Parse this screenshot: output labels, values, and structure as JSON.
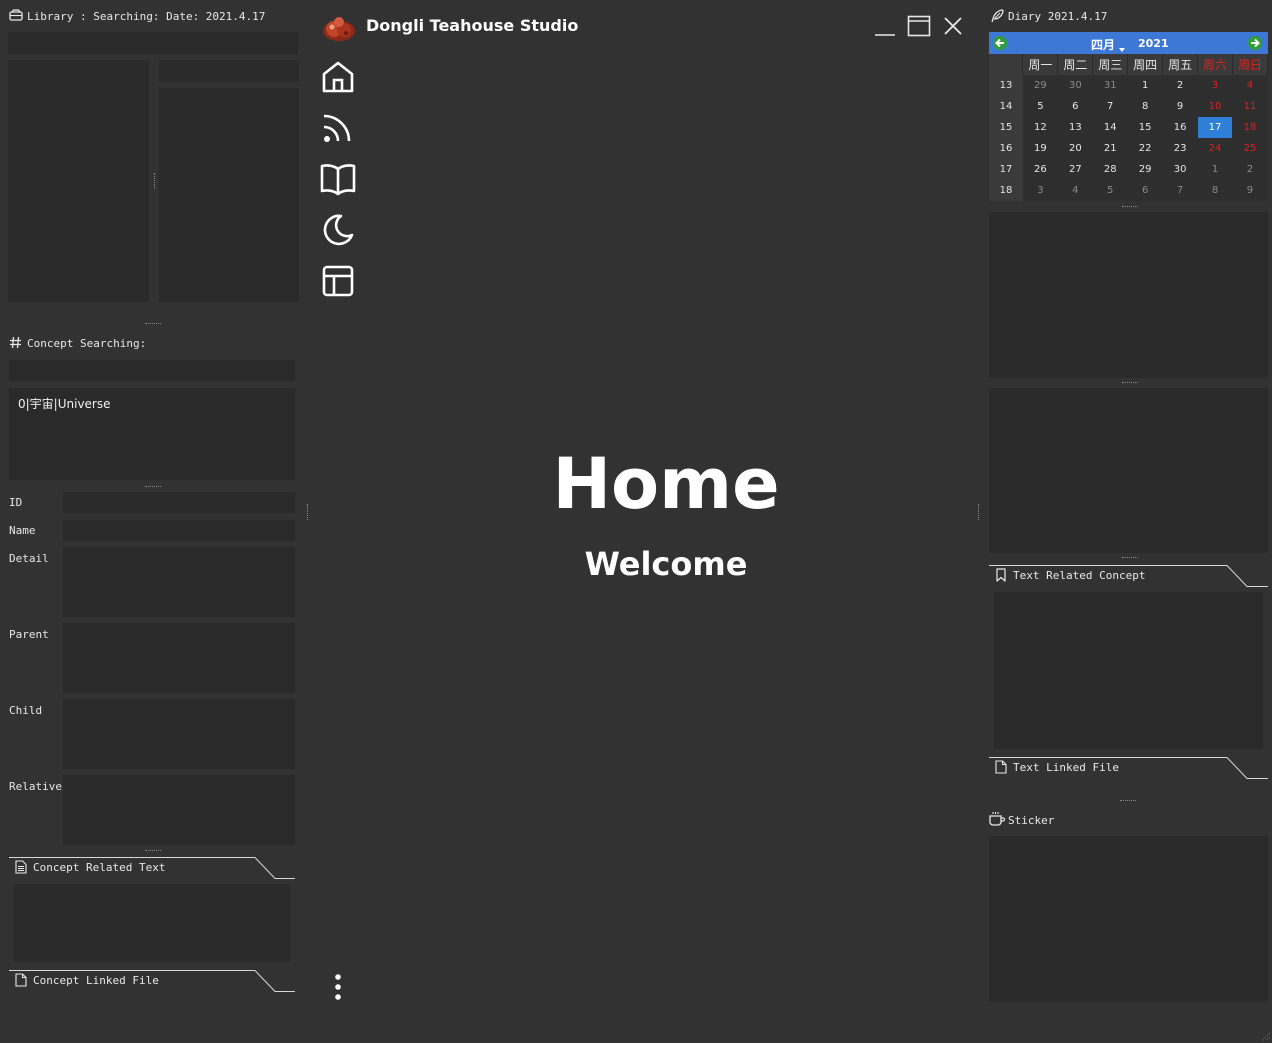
{
  "library": {
    "header": "Library : Searching: Date: 2021.4.17"
  },
  "concept": {
    "header": "Concept Searching:",
    "result": "0|宇宙|Universe",
    "fields": {
      "id": "ID",
      "name": "Name",
      "detail": "Detail",
      "parent": "Parent",
      "child": "Child",
      "relative": "Relative"
    },
    "related_text": "Concept Related Text",
    "linked_file": "Concept Linked File"
  },
  "app": {
    "title": "Dongli Teahouse Studio",
    "nav_icons": [
      "home-icon",
      "rss-icon",
      "book-icon",
      "moon-icon",
      "layout-icon"
    ]
  },
  "home": {
    "title": "Home",
    "subtitle": "Welcome"
  },
  "diary": {
    "header": "Diary 2021.4.17",
    "related_concept": "Text Related Concept",
    "linked_file": "Text Linked File",
    "sticker": "Sticker"
  },
  "calendar": {
    "month": "四月",
    "year": "2021",
    "weekdays": [
      "周一",
      "周二",
      "周三",
      "周四",
      "周五",
      "周六",
      "周日"
    ],
    "weeks": [
      {
        "num": "13",
        "days": [
          "29",
          "30",
          "31",
          "1",
          "2",
          "3",
          "4"
        ]
      },
      {
        "num": "14",
        "days": [
          "5",
          "6",
          "7",
          "8",
          "9",
          "10",
          "11"
        ]
      },
      {
        "num": "15",
        "days": [
          "12",
          "13",
          "14",
          "15",
          "16",
          "17",
          "18"
        ]
      },
      {
        "num": "16",
        "days": [
          "19",
          "20",
          "21",
          "22",
          "23",
          "24",
          "25"
        ]
      },
      {
        "num": "17",
        "days": [
          "26",
          "27",
          "28",
          "29",
          "30",
          "1",
          "2"
        ]
      },
      {
        "num": "18",
        "days": [
          "3",
          "4",
          "5",
          "6",
          "7",
          "8",
          "9"
        ]
      }
    ],
    "selected": "17",
    "colors": {
      "header": "#3d78d6",
      "selected": "#2f7ed8",
      "weekend": "#e02020",
      "nav_button": "#2f9e3a"
    }
  }
}
